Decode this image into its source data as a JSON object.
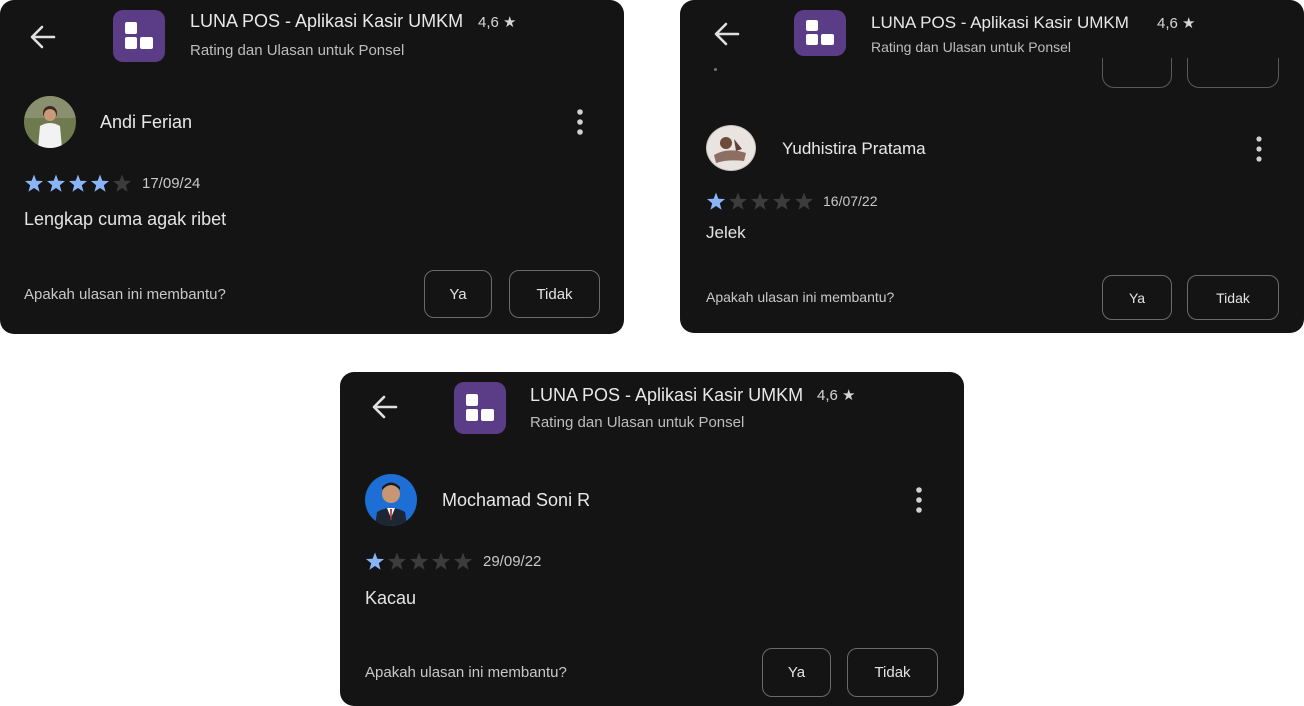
{
  "app": {
    "title": "LUNA POS - Aplikasi Kasir UMKM",
    "rating": "4,6 ★",
    "subtitle": "Rating dan Ulasan untuk Ponsel",
    "icon_color": "#5b3d87"
  },
  "colors": {
    "background": "#141414",
    "star_filled": "#8ab4f8",
    "star_empty": "#3c3c3c"
  },
  "reviews": [
    {
      "author": "Andi Ferian",
      "stars": 4,
      "date": "17/09/24",
      "text": "Lengkap cuma agak ribet",
      "helpful_question": "Apakah ulasan ini membantu?",
      "yes_label": "Ya",
      "no_label": "Tidak"
    },
    {
      "author": "Yudhistira Pratama",
      "stars": 1,
      "date": "16/07/22",
      "text": "Jelek",
      "helpful_question": "Apakah ulasan ini membantu?",
      "yes_label": "Ya",
      "no_label": "Tidak"
    },
    {
      "author": "Mochamad Soni R",
      "stars": 1,
      "date": "29/09/22",
      "text": "Kacau",
      "helpful_question": "Apakah ulasan ini membantu?",
      "yes_label": "Ya",
      "no_label": "Tidak"
    }
  ]
}
